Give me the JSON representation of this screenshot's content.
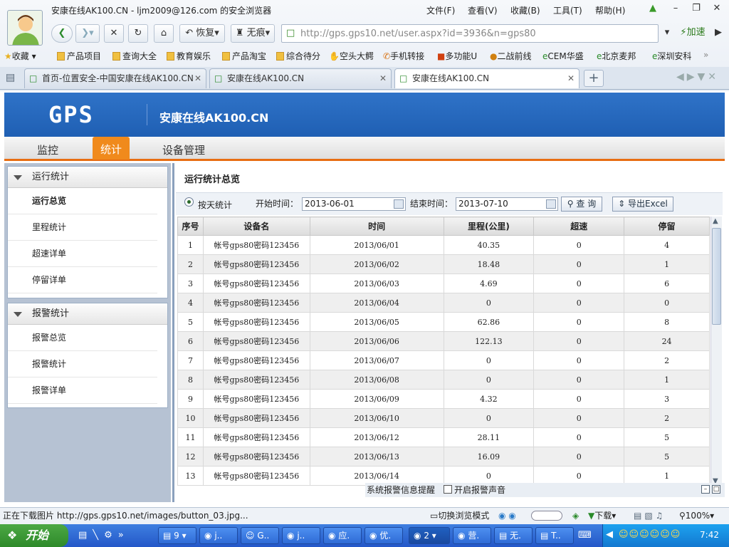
{
  "browser": {
    "window_title": "安康在线AK100.CN - ljm2009@126.com 的安全浏览器",
    "menu": [
      "文件(F)",
      "查看(V)",
      "收藏(B)",
      "工具(T)",
      "帮助(H)"
    ],
    "nav": {
      "restore": "恢复",
      "no_trace": "无痕",
      "speed": "加速"
    },
    "url": "http://gps.gps10.net/user.aspx?id=3936&n=gps80",
    "favorites": [
      "收藏",
      "产品项目",
      "查询大全",
      "教育娱乐",
      "产品淘宝",
      "综合待分",
      "空头大鳄",
      "手机转接",
      "多功能U",
      "二战前线",
      "CEM华盛",
      "北京麦邦",
      "深圳安科"
    ],
    "tabs": [
      {
        "label": "首页-位置安全-中国安康在线AK100.CN"
      },
      {
        "label": "安康在线AK100.CN"
      },
      {
        "label": "安康在线AK100.CN"
      }
    ],
    "status_text": "正在下载图片 http://gps.gps10.net/images/button_03.jpg...",
    "status_right": {
      "mode": "切换浏览模式",
      "download": "下载",
      "zoom": "100%"
    }
  },
  "site": {
    "logo": "GPS",
    "title": "安康在线AK100.CN",
    "nav_tabs": [
      "监控",
      "统计",
      "设备管理"
    ]
  },
  "sidebar": {
    "sections": [
      {
        "title": "运行统计",
        "items": [
          "运行总览",
          "里程统计",
          "超速详单",
          "停留详单"
        ]
      },
      {
        "title": "报警统计",
        "items": [
          "报警总览",
          "报警统计",
          "报警详单"
        ]
      }
    ]
  },
  "main": {
    "title": "运行统计总览",
    "by_day_label": "按天统计",
    "start_label": "开始时间：",
    "start_value": "2013-06-01",
    "end_label": "结束时间：",
    "end_value": "2013-07-10",
    "query_button": "查 询",
    "export_button": "导出Excel",
    "columns": [
      "序号",
      "设备名",
      "时间",
      "里程(公里)",
      "超速",
      "停留"
    ],
    "rows": [
      [
        "1",
        "帐号gps80密码123456",
        "2013/06/01",
        "40.35",
        "0",
        "4"
      ],
      [
        "2",
        "帐号gps80密码123456",
        "2013/06/02",
        "18.48",
        "0",
        "1"
      ],
      [
        "3",
        "帐号gps80密码123456",
        "2013/06/03",
        "4.69",
        "0",
        "6"
      ],
      [
        "4",
        "帐号gps80密码123456",
        "2013/06/04",
        "0",
        "0",
        "0"
      ],
      [
        "5",
        "帐号gps80密码123456",
        "2013/06/05",
        "62.86",
        "0",
        "8"
      ],
      [
        "6",
        "帐号gps80密码123456",
        "2013/06/06",
        "122.13",
        "0",
        "24"
      ],
      [
        "7",
        "帐号gps80密码123456",
        "2013/06/07",
        "0",
        "0",
        "2"
      ],
      [
        "8",
        "帐号gps80密码123456",
        "2013/06/08",
        "0",
        "0",
        "1"
      ],
      [
        "9",
        "帐号gps80密码123456",
        "2013/06/09",
        "4.32",
        "0",
        "3"
      ],
      [
        "10",
        "帐号gps80密码123456",
        "2013/06/10",
        "0",
        "0",
        "2"
      ],
      [
        "11",
        "帐号gps80密码123456",
        "2013/06/12",
        "28.11",
        "0",
        "5"
      ],
      [
        "12",
        "帐号gps80密码123456",
        "2013/06/13",
        "16.09",
        "0",
        "5"
      ],
      [
        "13",
        "帐号gps80密码123456",
        "2013/06/14",
        "0",
        "0",
        "1"
      ]
    ],
    "alarm_label": "系统报警信息提醒",
    "alarm_sound_label": "开启报警声音"
  },
  "taskbar": {
    "start": "开始",
    "tasks": [
      "9",
      "j..",
      "G..",
      "j..",
      "应.",
      "优.",
      "2",
      "营.",
      "无.",
      "T.."
    ],
    "clock": "7:42"
  },
  "colors": {
    "header_blue": "#2466bd",
    "active_tab_orange": "#f08a1c",
    "taskbar_blue": "#2f6bd6"
  }
}
